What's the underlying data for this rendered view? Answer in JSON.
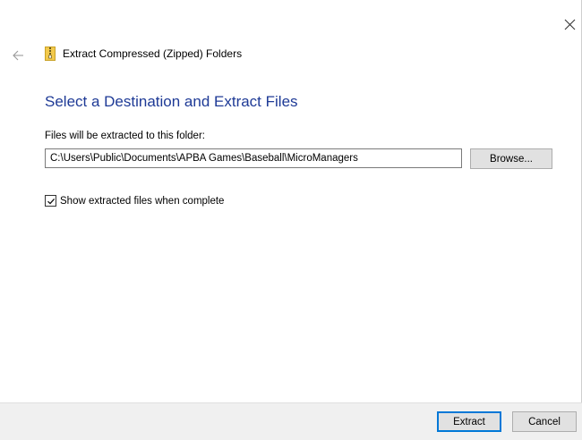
{
  "window": {
    "close_glyph": "✕",
    "back_icon": "arrow-left-icon",
    "close_icon": "close-icon"
  },
  "wizard": {
    "title": "Extract Compressed (Zipped) Folders",
    "title_icon": "zip-folder-icon",
    "heading": "Select a Destination and Extract Files",
    "path_label": "Files will be extracted to this folder:",
    "path_value": "C:\\Users\\Public\\Documents\\APBA Games\\Baseball\\MicroManagers",
    "browse_label": "Browse...",
    "show_files_label": "Show extracted files when complete",
    "show_files_checked": true
  },
  "footer": {
    "extract_label": "Extract",
    "cancel_label": "Cancel"
  },
  "colors": {
    "heading": "#1e3a96",
    "primary_border": "#0078d7",
    "footer_bg": "#f0f0f0",
    "button_bg": "#e1e1e1",
    "zip_icon": "#f2c94c"
  }
}
